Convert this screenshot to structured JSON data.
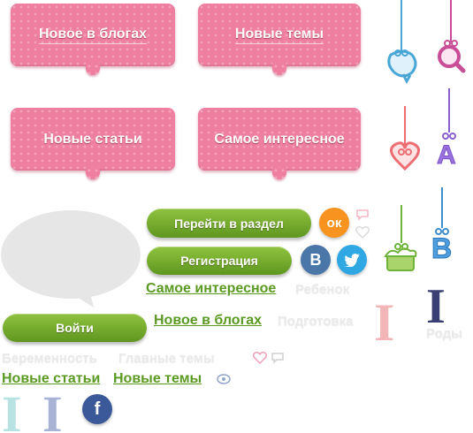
{
  "tabs": {
    "new_in_blogs": "Новое в блогах",
    "new_topics": "Новые темы",
    "new_articles": "Новые статьи",
    "most_interesting": "Самое интересное"
  },
  "buttons": {
    "go_to_section": "Перейти в раздел",
    "registration": "Регистрация",
    "login": "Войти"
  },
  "social": {
    "ok": "ок",
    "vk": "B",
    "fb": "f"
  },
  "links": {
    "most_interesting": "Самое интересное",
    "child": "Ребенок",
    "new_in_blogs": "Новое в блогах",
    "preparation": "Подготовка",
    "births": "Роды",
    "pregnancy": "Беременность",
    "hot_topics": "Главные темы",
    "new_articles": "Новые статьи",
    "new_topics": "Новые темы"
  },
  "hanging": {
    "letter_a": "A",
    "letter_b": "B"
  },
  "colors": {
    "tab_pink": "#ef7fa0",
    "green": "#6ea62a",
    "ok_orange": "#f7931e",
    "vk_blue": "#4a76a8",
    "twitter_blue": "#2fa7e3",
    "fb_blue": "#3b5998"
  }
}
